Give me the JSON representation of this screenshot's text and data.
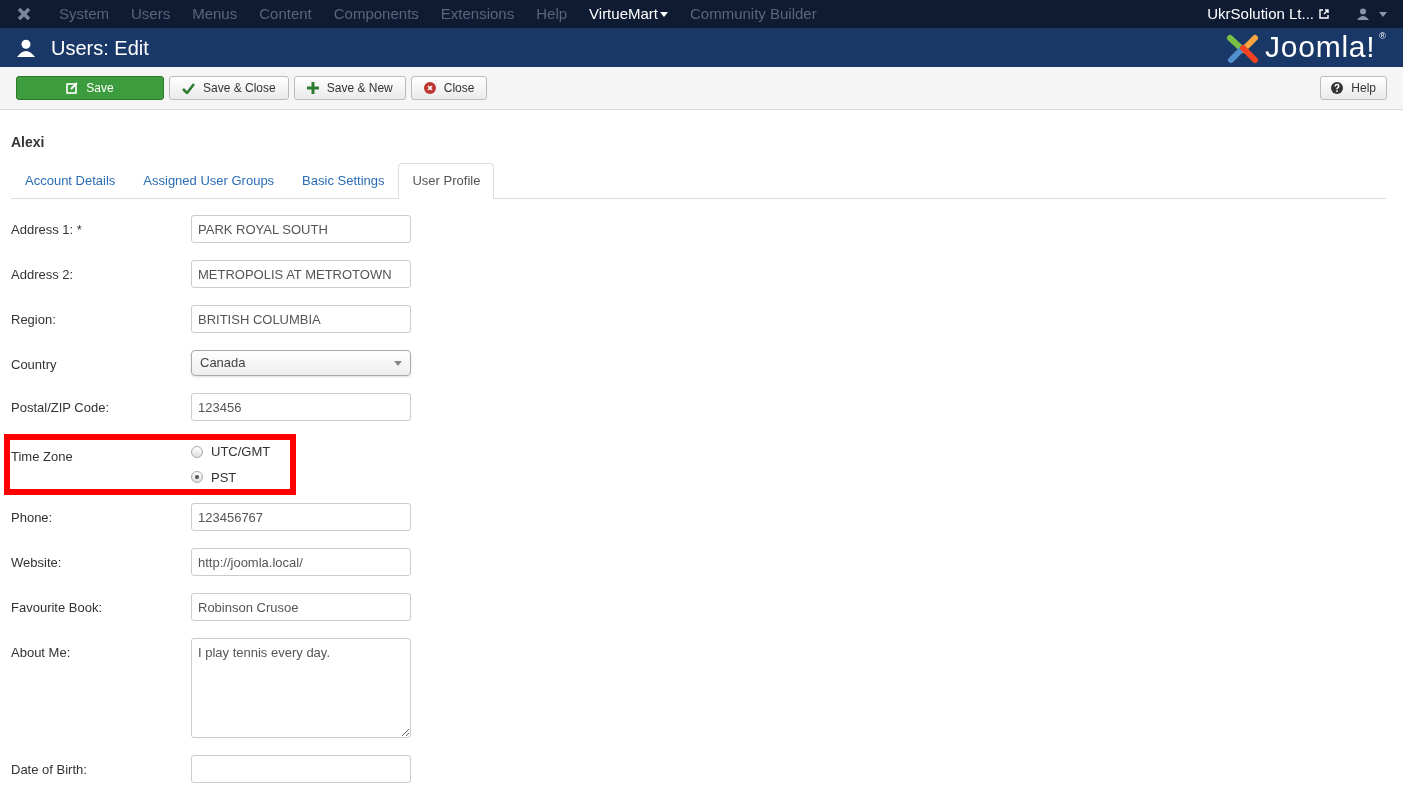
{
  "topbar": {
    "menu": [
      {
        "label": "System",
        "dropdown": false
      },
      {
        "label": "Users",
        "dropdown": false
      },
      {
        "label": "Menus",
        "dropdown": false
      },
      {
        "label": "Content",
        "dropdown": false
      },
      {
        "label": "Components",
        "dropdown": false
      },
      {
        "label": "Extensions",
        "dropdown": false
      },
      {
        "label": "Help",
        "dropdown": false
      },
      {
        "label": "VirtueMart",
        "dropdown": true
      },
      {
        "label": "Community Builder",
        "dropdown": false
      }
    ],
    "site_link": "UkrSolution Lt..."
  },
  "header": {
    "title": "Users: Edit",
    "logo_text": "Joomla!",
    "logo_mark": "®"
  },
  "toolbar": {
    "buttons": [
      {
        "label": "Save",
        "kind": "primary"
      },
      {
        "label": "Save & Close",
        "kind": "check"
      },
      {
        "label": "Save & New",
        "kind": "plus"
      },
      {
        "label": "Close",
        "kind": "close"
      }
    ],
    "help": "Help"
  },
  "user_name": "Alexi",
  "tabs": [
    {
      "label": "Account Details",
      "selected": false
    },
    {
      "label": "Assigned User Groups",
      "selected": false
    },
    {
      "label": "Basic Settings",
      "selected": false
    },
    {
      "label": "User Profile",
      "selected": true
    }
  ],
  "fields": [
    {
      "label": "Address 1: *",
      "kind": "text",
      "value": "PARK ROYAL SOUTH",
      "highlighted": false
    },
    {
      "label": "Address 2:",
      "kind": "text",
      "value": "METROPOLIS AT METROTOWN",
      "highlighted": false
    },
    {
      "label": "Region:",
      "kind": "text",
      "value": "BRITISH COLUMBIA",
      "highlighted": false
    },
    {
      "label": "Country",
      "kind": "select",
      "value": "Canada",
      "highlighted": false
    },
    {
      "label": "Postal/ZIP Code:",
      "kind": "text",
      "value": "123456",
      "highlighted": false
    },
    {
      "label": "Time Zone",
      "kind": "radio",
      "options": [
        {
          "label": "UTC/GMT",
          "selected": false
        },
        {
          "label": "PST",
          "selected": true
        }
      ],
      "highlighted": true
    },
    {
      "label": "Phone:",
      "kind": "text",
      "value": "123456767",
      "highlighted": false
    },
    {
      "label": "Website:",
      "kind": "text",
      "value": "http://joomla.local/",
      "highlighted": false
    },
    {
      "label": "Favourite Book:",
      "kind": "text",
      "value": "Robinson Crusoe",
      "highlighted": false
    },
    {
      "label": "About Me:",
      "kind": "textarea",
      "value": "I play tennis every day.",
      "highlighted": false
    },
    {
      "label": "Date of Birth:",
      "kind": "text",
      "highlighted": false
    }
  ]
}
